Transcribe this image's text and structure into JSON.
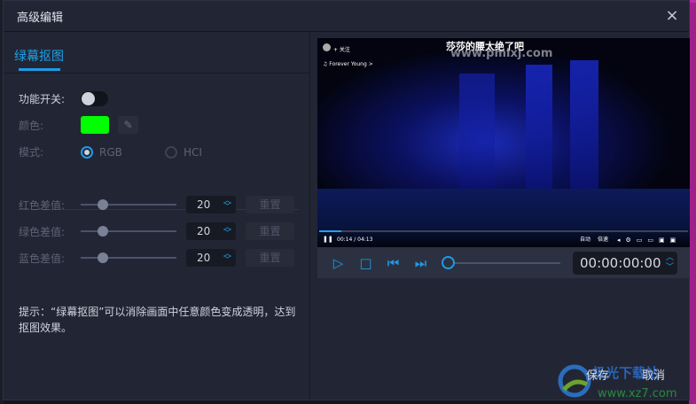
{
  "dialog": {
    "title": "高级编辑",
    "close_icon": "×"
  },
  "tabs": [
    {
      "label": "绿幕抠图",
      "active": true
    }
  ],
  "form": {
    "switch_label": "功能开关:",
    "switch_on": false,
    "color_label": "颜色:",
    "color_value": "#00ff00",
    "mode_label": "模式:",
    "modes": [
      "RGB",
      "HCI"
    ],
    "mode_selected": "RGB",
    "diffs": [
      {
        "label": "红色差值:",
        "value": "20",
        "max": 100,
        "reset": "重置"
      },
      {
        "label": "绿色差值:",
        "value": "20",
        "max": 100,
        "reset": "重置"
      },
      {
        "label": "蓝色差值:",
        "value": "20",
        "max": 100,
        "reset": "重置"
      }
    ],
    "tip": "提示：“绿幕抠图”可以消除画面中任意颜色变成透明，达到抠图效果。"
  },
  "video": {
    "title": "莎莎的腰太绝了吧",
    "watermark": "www.pmlxj.com",
    "follow": "+ 关注",
    "music": "♫ Forever Young >",
    "time": "00:14 / 04:13",
    "auto": "自动",
    "speed": "倍速",
    "progress": 0.06
  },
  "player": {
    "timecode": "00:00:00:00",
    "position": 0
  },
  "footer": {
    "save": "保存",
    "cancel": "取消"
  },
  "watermark_logo": {
    "name": "极光下载站",
    "url": "www.xz7.com"
  }
}
